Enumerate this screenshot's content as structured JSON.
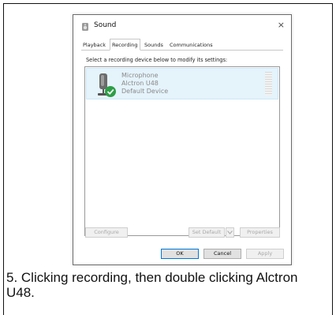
{
  "dialog": {
    "title": "Sound",
    "close_glyph": "×",
    "tabs": [
      {
        "label": "Playback"
      },
      {
        "label": "Recording"
      },
      {
        "label": "Sounds"
      },
      {
        "label": "Communications"
      }
    ],
    "active_tab": "Recording",
    "instruction": "Select a recording device below to modify its settings:",
    "device": {
      "name": "Microphone",
      "model": "Alctron U48",
      "status": "Default Device",
      "icon": "microphone-icon",
      "badge_icon": "check-badge-icon"
    },
    "buttons": {
      "configure": "Configure",
      "set_default": "Set Default",
      "properties": "Properties",
      "ok": "OK",
      "cancel": "Cancel",
      "apply": "Apply"
    },
    "icons": {
      "title": "speaker-icon",
      "set_default_arrow": "chevron-down-icon"
    },
    "colors": {
      "selection": "#e5f3fb",
      "check_badge": "#2e9e46",
      "primary_border": "#0078d7"
    }
  },
  "caption": "5. Clicking recording, then double clicking Alctron U48."
}
